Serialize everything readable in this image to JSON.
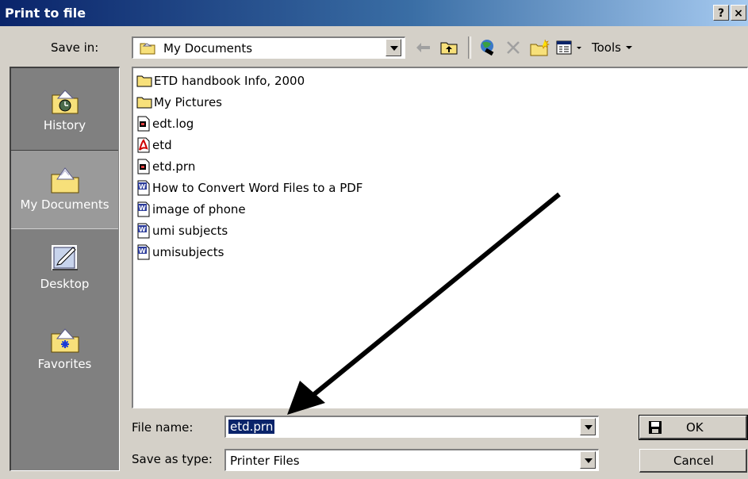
{
  "dialog": {
    "title": "Print to file",
    "help_button": "?",
    "close_button": "×"
  },
  "save_in": {
    "label": "Save in:",
    "value": "My Documents",
    "tools_label": "Tools"
  },
  "places": [
    {
      "label": "History",
      "icon": "history-icon"
    },
    {
      "label": "My Documents",
      "icon": "my-documents-icon"
    },
    {
      "label": "Desktop",
      "icon": "desktop-icon"
    },
    {
      "label": "Favorites",
      "icon": "favorites-icon"
    }
  ],
  "files": [
    {
      "name": "ETD handbook Info, 2000",
      "type": "folder"
    },
    {
      "name": "My Pictures",
      "type": "folder"
    },
    {
      "name": "edt.log",
      "type": "prn"
    },
    {
      "name": "etd",
      "type": "pdf"
    },
    {
      "name": "etd.prn",
      "type": "prn"
    },
    {
      "name": "How to Convert Word Files to a PDF",
      "type": "word"
    },
    {
      "name": "image of phone",
      "type": "word"
    },
    {
      "name": "umi subjects",
      "type": "word"
    },
    {
      "name": "umisubjects",
      "type": "word"
    }
  ],
  "file_name": {
    "label": "File name:",
    "value": "etd.prn"
  },
  "save_as_type": {
    "label": "Save as type:",
    "value": "Printer Files"
  },
  "buttons": {
    "ok": "OK",
    "cancel": "Cancel"
  },
  "colors": {
    "title_bar": "#0a246a",
    "selection": "#0a246a",
    "dialog_face": "#d4d0c8",
    "places_bar": "#808080"
  }
}
